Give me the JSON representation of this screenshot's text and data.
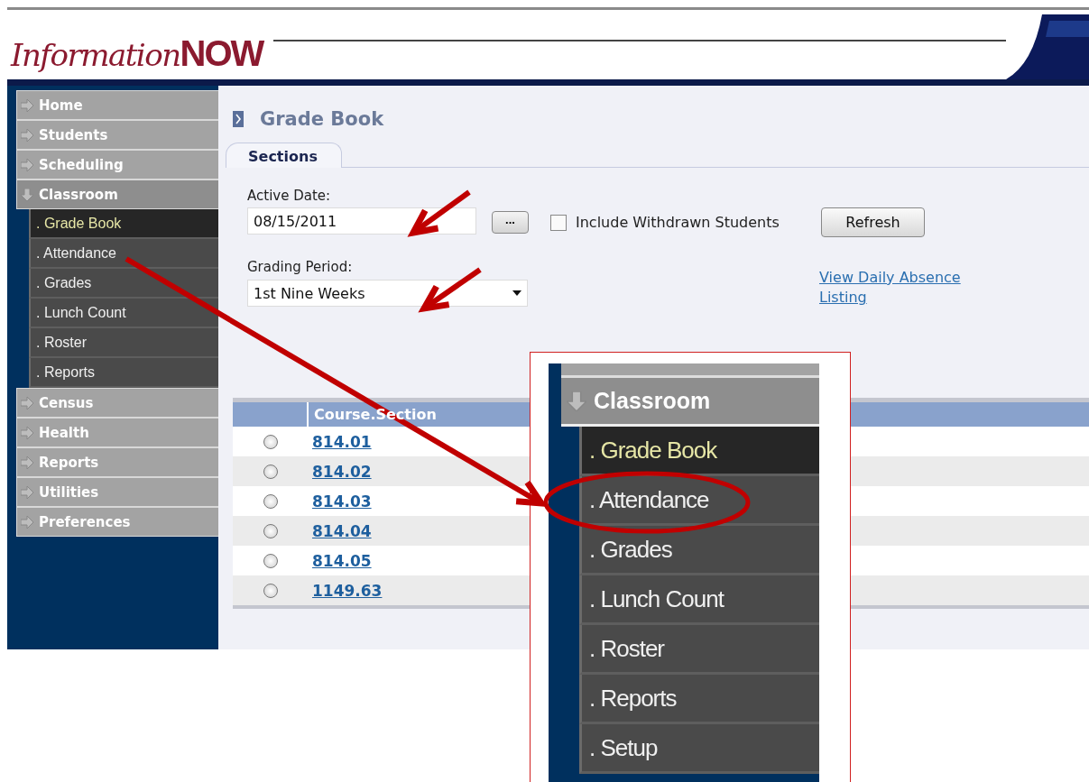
{
  "logo": {
    "script_part": "Information",
    "bold_part": "NOW"
  },
  "sidebar": {
    "items": [
      {
        "label": "Home",
        "expanded": false
      },
      {
        "label": "Students",
        "expanded": false
      },
      {
        "label": "Scheduling",
        "expanded": false
      },
      {
        "label": "Classroom",
        "expanded": true,
        "children": [
          {
            "label": ". Grade Book",
            "selected": true
          },
          {
            "label": ". Attendance",
            "selected": false
          },
          {
            "label": ". Grades",
            "selected": false
          },
          {
            "label": ". Lunch Count",
            "selected": false
          },
          {
            "label": ". Roster",
            "selected": false
          },
          {
            "label": ". Reports",
            "selected": false
          }
        ]
      },
      {
        "label": "Census",
        "expanded": false
      },
      {
        "label": "Health",
        "expanded": false
      },
      {
        "label": "Reports",
        "expanded": false
      },
      {
        "label": "Utilities",
        "expanded": false
      },
      {
        "label": "Preferences",
        "expanded": false
      }
    ]
  },
  "page_title": "Grade Book",
  "tabs": [
    {
      "label": "Sections",
      "selected": true
    }
  ],
  "form": {
    "active_date_label": "Active Date:",
    "active_date": "08/15/2011",
    "picker_button": "...",
    "include_withdrawn": {
      "label": "Include Withdrawn Students",
      "checked": false
    },
    "refresh_button": "Refresh",
    "grading_period_label": "Grading Period:",
    "grading_period": "1st Nine Weeks",
    "link": "View Daily Absence Listing"
  },
  "table": {
    "columns": [
      "Course.Section"
    ],
    "rows": [
      {
        "section": "814.01",
        "selected": false
      },
      {
        "section": "814.02",
        "selected": false
      },
      {
        "section": "814.03",
        "selected": false
      },
      {
        "section": "814.04",
        "selected": false
      },
      {
        "section": "814.05",
        "selected": false
      },
      {
        "section": "1149.63",
        "selected": false
      }
    ]
  },
  "inset": {
    "header": {
      "label": "Classroom",
      "expanded": true
    },
    "items": [
      {
        "label": ". Grade Book",
        "selected": true
      },
      {
        "label": ". Attendance",
        "selected": false
      },
      {
        "label": ". Grades",
        "selected": false
      },
      {
        "label": ". Lunch Count",
        "selected": false
      },
      {
        "label": ". Roster",
        "selected": false
      },
      {
        "label": ". Reports",
        "selected": false
      },
      {
        "label": ". Setup",
        "selected": false
      }
    ]
  }
}
